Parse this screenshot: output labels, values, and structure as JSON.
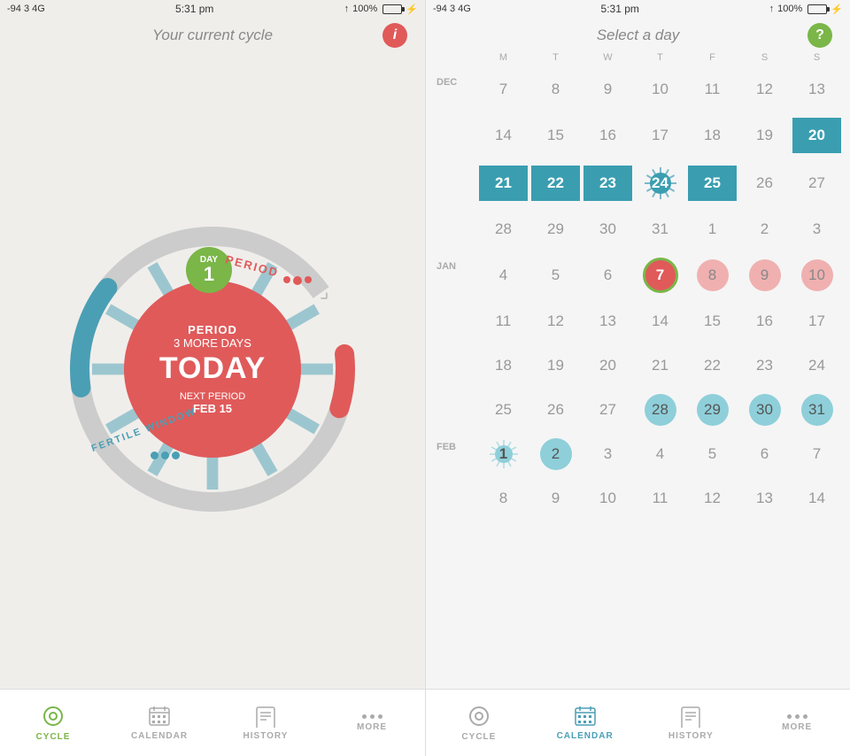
{
  "left": {
    "statusBar": {
      "signal": "-94 3  4G",
      "time": "5:31 pm",
      "arrow": "↑",
      "battery": "100%"
    },
    "header": {
      "title": "Your current cycle",
      "infoBtn": "i"
    },
    "cycle": {
      "dayLabel": "DAY",
      "dayNumber": "1",
      "centerTopLabel": "PERIOD",
      "centerMidLabel": "3 MORE DAYS",
      "todayLabel": "TODAY",
      "nextPeriodLabel": "NEXT PERIOD",
      "nextPeriodDate": "FEB 15",
      "periodArcText": "PERIOD",
      "fertileText": "FERTILE WINDOW"
    },
    "nav": [
      {
        "label": "CYCLE",
        "icon": "⊙",
        "active": true
      },
      {
        "label": "CALENDAR",
        "icon": "▦",
        "active": false
      },
      {
        "label": "HISTORY",
        "icon": "☰",
        "active": false
      },
      {
        "label": "MORE",
        "icon": "···",
        "active": false
      }
    ]
  },
  "right": {
    "statusBar": {
      "signal": "-94 3  4G",
      "time": "5:31 pm",
      "arrow": "↑",
      "battery": "100%"
    },
    "header": {
      "title": "Select a day",
      "helpBtn": "?"
    },
    "calendar": {
      "dayLabels": [
        "M",
        "T",
        "W",
        "T",
        "F",
        "S",
        "S"
      ],
      "weeks": [
        {
          "month": "DEC",
          "days": [
            {
              "num": "7",
              "type": "normal"
            },
            {
              "num": "8",
              "type": "normal"
            },
            {
              "num": "9",
              "type": "normal"
            },
            {
              "num": "10",
              "type": "normal"
            },
            {
              "num": "11",
              "type": "normal"
            },
            {
              "num": "12",
              "type": "normal"
            },
            {
              "num": "13",
              "type": "normal"
            }
          ]
        },
        {
          "month": "",
          "days": [
            {
              "num": "14",
              "type": "normal"
            },
            {
              "num": "15",
              "type": "normal"
            },
            {
              "num": "16",
              "type": "normal"
            },
            {
              "num": "17",
              "type": "normal"
            },
            {
              "num": "18",
              "type": "normal"
            },
            {
              "num": "19",
              "type": "normal"
            },
            {
              "num": "20",
              "type": "teal-sq"
            }
          ]
        },
        {
          "month": "",
          "days": [
            {
              "num": "21",
              "type": "teal-sq"
            },
            {
              "num": "22",
              "type": "teal-sq"
            },
            {
              "num": "23",
              "type": "teal-sq"
            },
            {
              "num": "24",
              "type": "burst-teal"
            },
            {
              "num": "25",
              "type": "teal-sq"
            },
            {
              "num": "26",
              "type": "normal"
            },
            {
              "num": "27",
              "type": "normal"
            }
          ]
        },
        {
          "month": "",
          "days": [
            {
              "num": "28",
              "type": "normal"
            },
            {
              "num": "29",
              "type": "normal"
            },
            {
              "num": "30",
              "type": "normal"
            },
            {
              "num": "31",
              "type": "normal"
            },
            {
              "num": "1",
              "type": "normal"
            },
            {
              "num": "2",
              "type": "normal"
            },
            {
              "num": "3",
              "type": "normal"
            }
          ]
        },
        {
          "month": "JAN",
          "days": [
            {
              "num": "4",
              "type": "normal"
            },
            {
              "num": "5",
              "type": "normal"
            },
            {
              "num": "6",
              "type": "normal"
            },
            {
              "num": "7",
              "type": "today-green-red"
            },
            {
              "num": "8",
              "type": "pink-dot"
            },
            {
              "num": "9",
              "type": "pink-dot"
            },
            {
              "num": "10",
              "type": "pink-dot"
            }
          ]
        },
        {
          "month": "",
          "days": [
            {
              "num": "11",
              "type": "normal"
            },
            {
              "num": "12",
              "type": "normal"
            },
            {
              "num": "13",
              "type": "normal"
            },
            {
              "num": "14",
              "type": "normal"
            },
            {
              "num": "15",
              "type": "normal"
            },
            {
              "num": "16",
              "type": "normal"
            },
            {
              "num": "17",
              "type": "normal"
            }
          ]
        },
        {
          "month": "",
          "days": [
            {
              "num": "18",
              "type": "normal"
            },
            {
              "num": "19",
              "type": "normal"
            },
            {
              "num": "20",
              "type": "normal"
            },
            {
              "num": "21",
              "type": "normal"
            },
            {
              "num": "22",
              "type": "normal"
            },
            {
              "num": "23",
              "type": "normal"
            },
            {
              "num": "24",
              "type": "normal"
            }
          ]
        },
        {
          "month": "",
          "days": [
            {
              "num": "25",
              "type": "normal"
            },
            {
              "num": "26",
              "type": "normal"
            },
            {
              "num": "27",
              "type": "normal"
            },
            {
              "num": "28",
              "type": "teal-dot"
            },
            {
              "num": "29",
              "type": "teal-dot"
            },
            {
              "num": "30",
              "type": "teal-dot"
            },
            {
              "num": "31",
              "type": "teal-dot"
            }
          ]
        },
        {
          "month": "FEB",
          "days": [
            {
              "num": "1",
              "type": "burst-teal-small"
            },
            {
              "num": "2",
              "type": "teal-dot"
            },
            {
              "num": "3",
              "type": "normal"
            },
            {
              "num": "4",
              "type": "normal"
            },
            {
              "num": "5",
              "type": "normal"
            },
            {
              "num": "6",
              "type": "normal"
            },
            {
              "num": "7",
              "type": "normal"
            }
          ]
        },
        {
          "month": "",
          "days": [
            {
              "num": "8",
              "type": "normal"
            },
            {
              "num": "9",
              "type": "normal"
            },
            {
              "num": "10",
              "type": "normal"
            },
            {
              "num": "11",
              "type": "normal"
            },
            {
              "num": "12",
              "type": "normal"
            },
            {
              "num": "13",
              "type": "normal"
            },
            {
              "num": "14",
              "type": "normal"
            }
          ]
        }
      ]
    },
    "nav": [
      {
        "label": "CYCLE",
        "icon": "⊙",
        "active": false
      },
      {
        "label": "CALENDAR",
        "icon": "▦",
        "active": true
      },
      {
        "label": "HISTORY",
        "icon": "☰",
        "active": false
      },
      {
        "label": "MORE",
        "icon": "···",
        "active": false
      }
    ]
  }
}
